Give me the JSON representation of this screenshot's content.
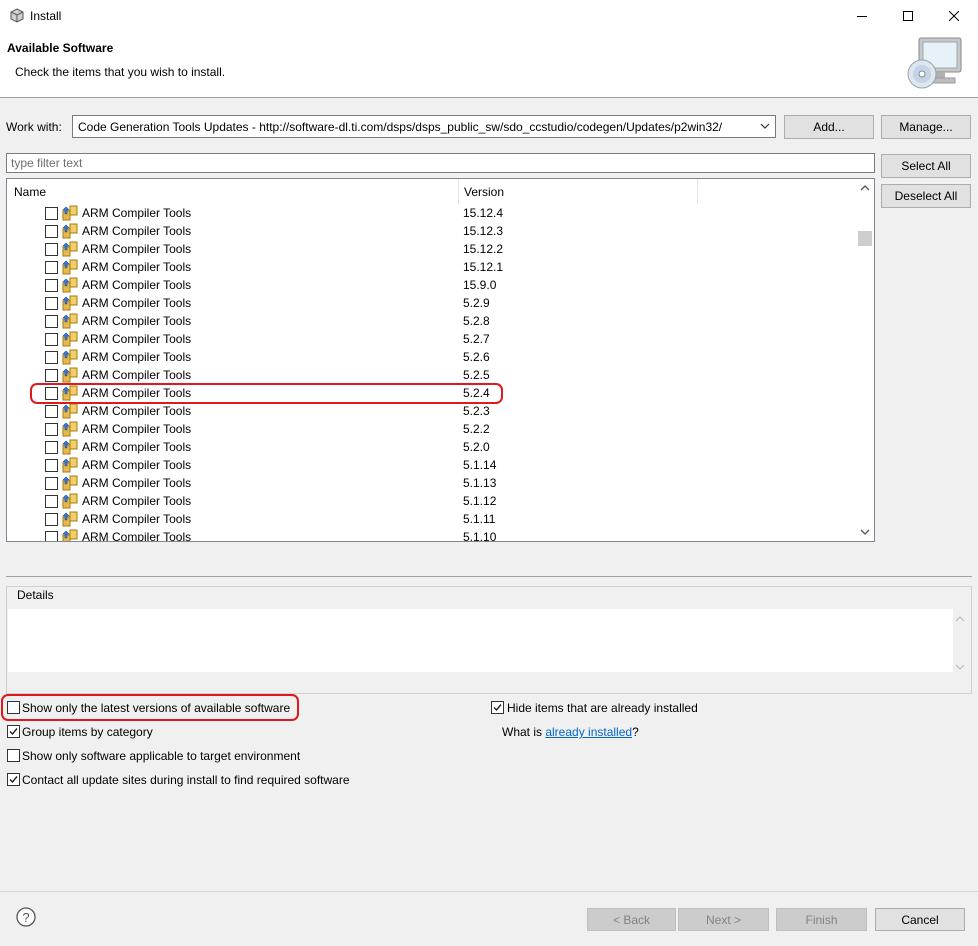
{
  "window": {
    "title": "Install"
  },
  "banner": {
    "title": "Available Software",
    "subtitle": "Check the items that you wish to install."
  },
  "work_with": {
    "label": "Work with:",
    "value": "Code Generation Tools Updates - http://software-dl.ti.com/dsps/dsps_public_sw/sdo_ccstudio/codegen/Updates/p2win32/",
    "add_label": "Add...",
    "manage_label": "Manage..."
  },
  "filter": {
    "placeholder": "type filter text"
  },
  "table": {
    "columns": [
      "Name",
      "Version"
    ],
    "rows": [
      {
        "name": "ARM Compiler Tools",
        "version": "15.12.4"
      },
      {
        "name": "ARM Compiler Tools",
        "version": "15.12.3"
      },
      {
        "name": "ARM Compiler Tools",
        "version": "15.12.2"
      },
      {
        "name": "ARM Compiler Tools",
        "version": "15.12.1"
      },
      {
        "name": "ARM Compiler Tools",
        "version": "15.9.0"
      },
      {
        "name": "ARM Compiler Tools",
        "version": "5.2.9"
      },
      {
        "name": "ARM Compiler Tools",
        "version": "5.2.8"
      },
      {
        "name": "ARM Compiler Tools",
        "version": "5.2.7"
      },
      {
        "name": "ARM Compiler Tools",
        "version": "5.2.6"
      },
      {
        "name": "ARM Compiler Tools",
        "version": "5.2.5"
      },
      {
        "name": "ARM Compiler Tools",
        "version": "5.2.4"
      },
      {
        "name": "ARM Compiler Tools",
        "version": "5.2.3"
      },
      {
        "name": "ARM Compiler Tools",
        "version": "5.2.2"
      },
      {
        "name": "ARM Compiler Tools",
        "version": "5.2.0"
      },
      {
        "name": "ARM Compiler Tools",
        "version": "5.1.14"
      },
      {
        "name": "ARM Compiler Tools",
        "version": "5.1.13"
      },
      {
        "name": "ARM Compiler Tools",
        "version": "5.1.12"
      },
      {
        "name": "ARM Compiler Tools",
        "version": "5.1.11"
      },
      {
        "name": "ARM Compiler Tools",
        "version": "5.1.10"
      }
    ]
  },
  "side_buttons": {
    "select_all": "Select All",
    "deselect_all": "Deselect All"
  },
  "details": {
    "label": "Details"
  },
  "options": {
    "latest_only": {
      "label": "Show only the latest versions of available software",
      "checked": false
    },
    "group_by_category": {
      "label": "Group items by category",
      "checked": true
    },
    "applicable_only": {
      "label": "Show only software applicable to target environment",
      "checked": false
    },
    "contact_all": {
      "label": "Contact all update sites during install to find required software",
      "checked": true
    },
    "hide_installed": {
      "label": "Hide items that are already installed",
      "checked": true
    }
  },
  "what_is": {
    "prefix": "What is ",
    "link": "already installed",
    "suffix": "?"
  },
  "footer": {
    "back": "< Back",
    "next": "Next >",
    "finish": "Finish",
    "cancel": "Cancel",
    "help_glyph": "?"
  },
  "colors": {
    "highlight": "#e0191d",
    "link": "#0066cc",
    "accent": "#0078d7"
  }
}
